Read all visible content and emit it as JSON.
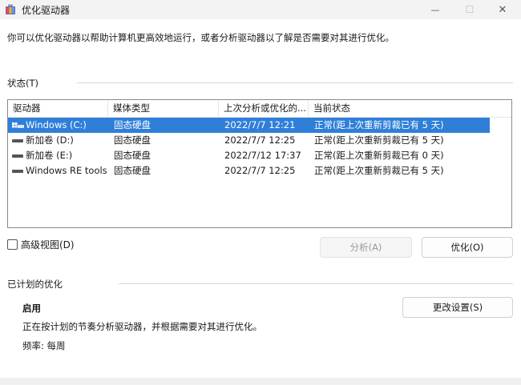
{
  "window": {
    "title": "优化驱动器",
    "minimize_glyph": "—",
    "maximize_glyph": "☐",
    "close_glyph": "✕"
  },
  "description": "你可以优化驱动器以帮助计算机更高效地运行，或者分析驱动器以了解是否需要对其进行优化。",
  "status_section": {
    "label": "状态(T)"
  },
  "columns": [
    "驱动器",
    "媒体类型",
    "上次分析或优化的...",
    "当前状态"
  ],
  "drives": [
    {
      "name": "Windows (C:)",
      "media": "固态硬盘",
      "last": "2022/7/7 12:21",
      "status": "正常(距上次重新剪裁已有 5 天)",
      "icon": "windows-drive-icon",
      "selected": true
    },
    {
      "name": "新加卷 (D:)",
      "media": "固态硬盘",
      "last": "2022/7/7 12:25",
      "status": "正常(距上次重新剪裁已有 5 天)",
      "icon": "drive-icon",
      "selected": false
    },
    {
      "name": "新加卷 (E:)",
      "media": "固态硬盘",
      "last": "2022/7/12 17:37",
      "status": "正常(距上次重新剪裁已有 0 天)",
      "icon": "drive-icon",
      "selected": false
    },
    {
      "name": "Windows RE tools",
      "media": "固态硬盘",
      "last": "2022/7/7 12:25",
      "status": "正常(距上次重新剪裁已有 5 天)",
      "icon": "drive-icon",
      "selected": false
    }
  ],
  "advanced_view": {
    "label": "高级视图(D)",
    "checked": false
  },
  "buttons": {
    "analyze": "分析(A)",
    "optimize": "优化(O)",
    "change_settings": "更改设置(S)"
  },
  "scheduled": {
    "label": "已计划的优化",
    "state": "启用",
    "detail": "正在按计划的节奏分析驱动器，并根据需要对其进行优化。",
    "frequency": "频率: 每周"
  },
  "colors": {
    "selection": "#2f7fd9",
    "titlebar": "#f3f3f3"
  }
}
